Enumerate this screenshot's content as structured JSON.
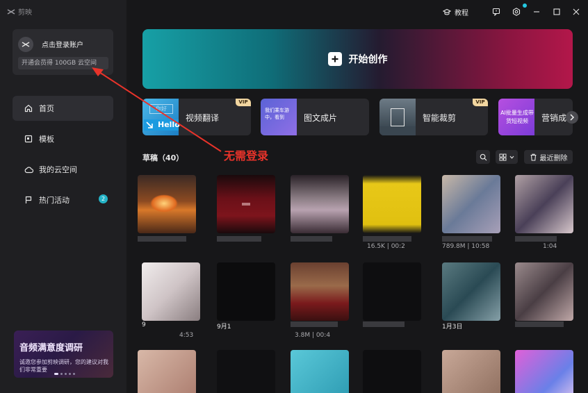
{
  "app": {
    "brand_name": "剪映"
  },
  "account": {
    "login_label": "点击登录账户",
    "vip_label": "开通会员得 100GB 云空间"
  },
  "nav": [
    {
      "label": "首页",
      "icon": "home-icon",
      "active": true
    },
    {
      "label": "模板",
      "icon": "template-icon",
      "active": false
    },
    {
      "label": "我的云空间",
      "icon": "cloud-icon",
      "active": false
    },
    {
      "label": "热门活动",
      "icon": "flag-icon",
      "active": false,
      "badge": "2"
    }
  ],
  "survey": {
    "title": "音频满意度调研",
    "desc": "诚邀您参加剪映调研，您的建议对我们非常重要"
  },
  "titlebar": {
    "tutorial_label": "教程"
  },
  "hero": {
    "label": "开始创作"
  },
  "features": [
    {
      "label": "视频翻译",
      "thumb_text": "Hello",
      "vip": "VIP"
    },
    {
      "label": "图文成片",
      "thumb_text": "我们乘车游中，看到",
      "vip": ""
    },
    {
      "label": "智能裁剪",
      "thumb_text": "",
      "vip": "VIP"
    },
    {
      "label": "营销成",
      "thumb_text": "AI批量生成带货短视频",
      "vip": ""
    }
  ],
  "drafts": {
    "title": "草稿（40）",
    "recent_delete_label": "最近删除",
    "captions": [
      {
        "text": ""
      },
      {
        "text": ""
      },
      {
        "text": ""
      },
      {
        "text": "16.5K | 00:2"
      },
      {
        "text": "789.8M | 10:58"
      },
      {
        "text": "1:04"
      },
      {
        "text": "9"
      },
      {
        "text": "9月1"
      },
      {
        "text": "3.8M | 00:4"
      },
      {
        "text": ""
      },
      {
        "text": "1月3日"
      },
      {
        "text": ""
      }
    ],
    "captions_row2": [
      "4:53",
      "",
      "",
      "",
      "",
      ""
    ]
  },
  "annotation": {
    "text": "无需登录",
    "color": "#e8332a"
  },
  "colors": {
    "accent": "#24b3c7",
    "hero_start": "#17a0a6",
    "hero_end": "#b3174a",
    "vip": "#f2d6a0"
  }
}
